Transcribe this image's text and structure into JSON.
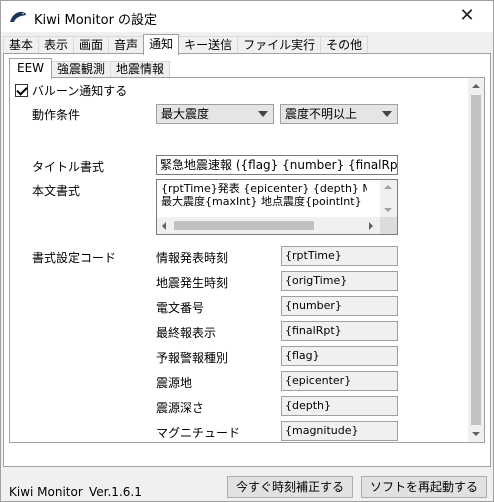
{
  "window": {
    "title": "Kiwi Monitor の設定",
    "close_glyph": "✕"
  },
  "main_tabs": [
    {
      "label": "基本"
    },
    {
      "label": "表示"
    },
    {
      "label": "画面"
    },
    {
      "label": "音声"
    },
    {
      "label": "通知"
    },
    {
      "label": "キー送信"
    },
    {
      "label": "ファイル実行"
    },
    {
      "label": "その他"
    }
  ],
  "sub_tabs": [
    {
      "label": "EEW"
    },
    {
      "label": "強震観測"
    },
    {
      "label": "地震情報"
    }
  ],
  "balloon": {
    "label": "バルーン通知する",
    "checked": true
  },
  "condition": {
    "label": "動作条件",
    "select1": "最大震度",
    "select2": "震度不明以上"
  },
  "title_format": {
    "label": "タイトル書式",
    "value": "緊急地震速報 ({flag} {number} {finalRpt})"
  },
  "body_format": {
    "label": "本文書式",
    "line1": "{rptTime}発表 {epicenter} {depth} M{magnitu",
    "line2": "最大震度{maxInt} 地点震度{pointInt}"
  },
  "codes": {
    "label": "書式設定コード",
    "items": [
      {
        "name": "情報発表時刻",
        "code": "{rptTime}"
      },
      {
        "name": "地震発生時刻",
        "code": "{origTime}"
      },
      {
        "name": "電文番号",
        "code": "{number}"
      },
      {
        "name": "最終報表示",
        "code": "{finalRpt}"
      },
      {
        "name": "予報警報種別",
        "code": "{flag}"
      },
      {
        "name": "震源地",
        "code": "{epicenter}"
      },
      {
        "name": "震源深さ",
        "code": "{depth}"
      },
      {
        "name": "マグニチュード",
        "code": "{magnitude}"
      }
    ]
  },
  "footer": {
    "app_name": "Kiwi Monitor",
    "version": "Ver.1.6.1",
    "time_button": "今すぐ時刻補正する",
    "restart_button": "ソフトを再起動する"
  },
  "icons": {
    "app": "kiwi-bird-icon",
    "close": "close-icon",
    "dropdown": "chevron-down-icon",
    "scroll_up": "scroll-up-arrow-icon",
    "scroll_down": "scroll-down-arrow-icon",
    "scroll_left": "scroll-left-arrow-icon",
    "scroll_right": "scroll-right-arrow-icon"
  },
  "colors": {
    "window_bg": "#f0f0f0",
    "panel_bg": "#ffffff",
    "border": "#a0a0a0",
    "button_bg": "#e1e1e1"
  }
}
